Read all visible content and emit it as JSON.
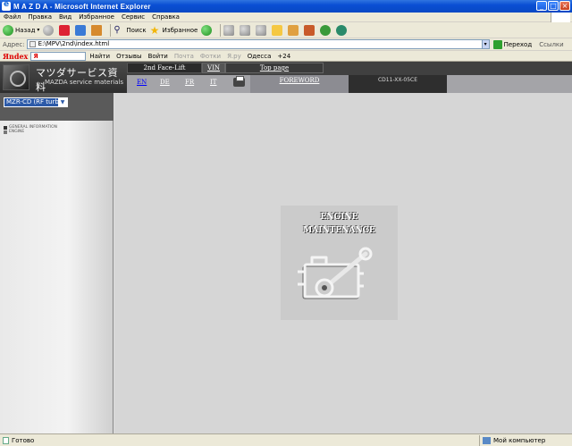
{
  "window": {
    "title": "M A Z D A - Microsoft Internet Explorer"
  },
  "menu": [
    "Файл",
    "Правка",
    "Вид",
    "Избранное",
    "Сервис",
    "Справка"
  ],
  "toolbar": {
    "back": "Назад",
    "search": "Поиск",
    "favorites": "Избранное"
  },
  "address": {
    "label": "Адрес:",
    "url": "E:\\MPV\\2nd\\index.html",
    "go": "Переход",
    "links": "Ссылки"
  },
  "yandex": {
    "logo": "Яndex",
    "find": "Найти",
    "reviews": "Отзывы",
    "login": "Войти",
    "mail": "Почта",
    "photos": "Фотки",
    "yaru": "Я.ру",
    "city": "Одесса",
    "temp": "+24"
  },
  "site": {
    "logo_jp": "マツダサービス資料",
    "logo_en": "MAZDA service materials",
    "tabs": {
      "lift": "2nd Face-Lift",
      "vin": "VIN",
      "top": "Top page"
    },
    "langs": [
      "EN",
      "DE",
      "FR",
      "IT"
    ],
    "foreword": "FOREWORD",
    "code": "CD11-XX-05CE",
    "model": "MZR-CD (RF turbo)",
    "tree": [
      "GENERAL INFORMATION",
      "ENGINE"
    ],
    "engine_title_1": "ENGINE",
    "engine_title_2": "MAINTENANCE"
  },
  "status": {
    "text": "Готово",
    "zone": "Мой компьютер"
  }
}
